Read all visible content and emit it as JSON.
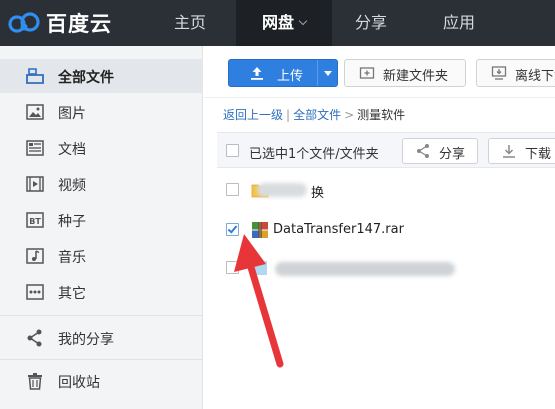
{
  "app": {
    "logo_text": "百度云"
  },
  "nav": {
    "items": [
      {
        "label": "主页"
      },
      {
        "label": "网盘"
      },
      {
        "label": "分享"
      },
      {
        "label": "应用"
      }
    ]
  },
  "sidebar": {
    "items": [
      {
        "label": "全部文件",
        "icon": "folder-icon"
      },
      {
        "label": "图片",
        "icon": "image-icon"
      },
      {
        "label": "文档",
        "icon": "document-icon"
      },
      {
        "label": "视频",
        "icon": "video-icon"
      },
      {
        "label": "种子",
        "icon": "bt-icon"
      },
      {
        "label": "音乐",
        "icon": "music-icon"
      },
      {
        "label": "其它",
        "icon": "more-icon"
      }
    ],
    "share_label": "我的分享",
    "trash_label": "回收站"
  },
  "toolbar": {
    "upload_label": "上传",
    "new_folder_label": "新建文件夹",
    "offline_label": "离线下载"
  },
  "breadcrumb": {
    "back": "返回上一级",
    "sep1": "|",
    "all_files": "全部文件",
    "sep2": ">",
    "current": "测量软件"
  },
  "selection": {
    "text": "已选中1个文件/文件夹",
    "share_label": "分享",
    "download_label": "下载"
  },
  "files": [
    {
      "name_visible": "换",
      "checked": false
    },
    {
      "name": "DataTransfer147.rar",
      "checked": true
    },
    {
      "checked": false
    }
  ],
  "colors": {
    "topbar": "#2b2f36",
    "accent": "#2f7fe0",
    "arrow": "#e8353a"
  }
}
